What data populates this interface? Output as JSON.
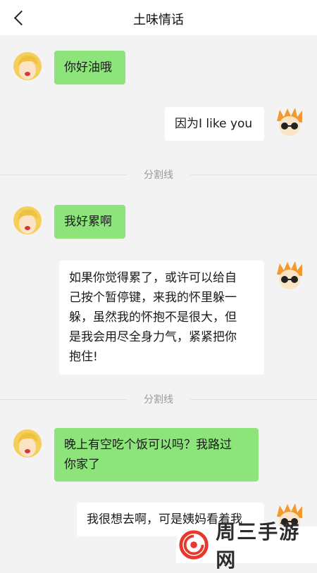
{
  "header": {
    "title": "土味情话"
  },
  "messages": [
    {
      "side": "left",
      "text": "你好油哦"
    },
    {
      "side": "right",
      "text": "因为I like you"
    },
    {
      "side": "left",
      "text": "我好累啊"
    },
    {
      "side": "right",
      "lines": [
        "如果你觉得累了，或许可以给自",
        "己按个暂停键，来我的怀里躲一",
        "躲，虽然我的怀抱不是很大，但",
        "是我会用尽全身力气，紧紧把你",
        "抱住!"
      ]
    },
    {
      "side": "left",
      "lines": [
        "晚上有空吃个饭可以吗？我路过",
        "你家了"
      ]
    },
    {
      "side": "right",
      "text": "我很想去啊，可是姨妈看着我"
    }
  ],
  "dividers": [
    "分割线",
    "分割线"
  ],
  "watermark": {
    "text": "周三手游网"
  },
  "icons": {
    "back": "chevron-left-icon",
    "left_avatar": "blonde-girl-avatar-icon",
    "right_avatar": "spiky-hair-sunglasses-avatar-icon"
  },
  "colors": {
    "green_bubble": "#8de47a",
    "white_bubble": "#ffffff",
    "background": "#f3f3f3",
    "watermark_red": "#e8382c"
  }
}
